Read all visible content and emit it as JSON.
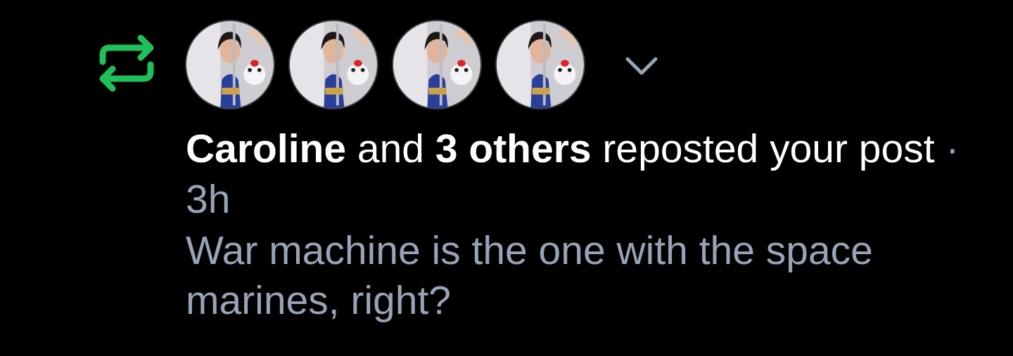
{
  "notification": {
    "icon": "repost-icon",
    "accent_color": "#1fbf5b",
    "avatars": [
      {
        "icon": "avatar"
      },
      {
        "icon": "avatar"
      },
      {
        "icon": "avatar"
      },
      {
        "icon": "avatar"
      }
    ],
    "expand_icon": "chevron-down-icon",
    "actor_name": "Caroline",
    "connector": " and ",
    "others": "3 others",
    "action": " reposted your post",
    "separator": " · ",
    "time": "3h",
    "preview_text": "War machine is the one with the space marines, right?"
  }
}
